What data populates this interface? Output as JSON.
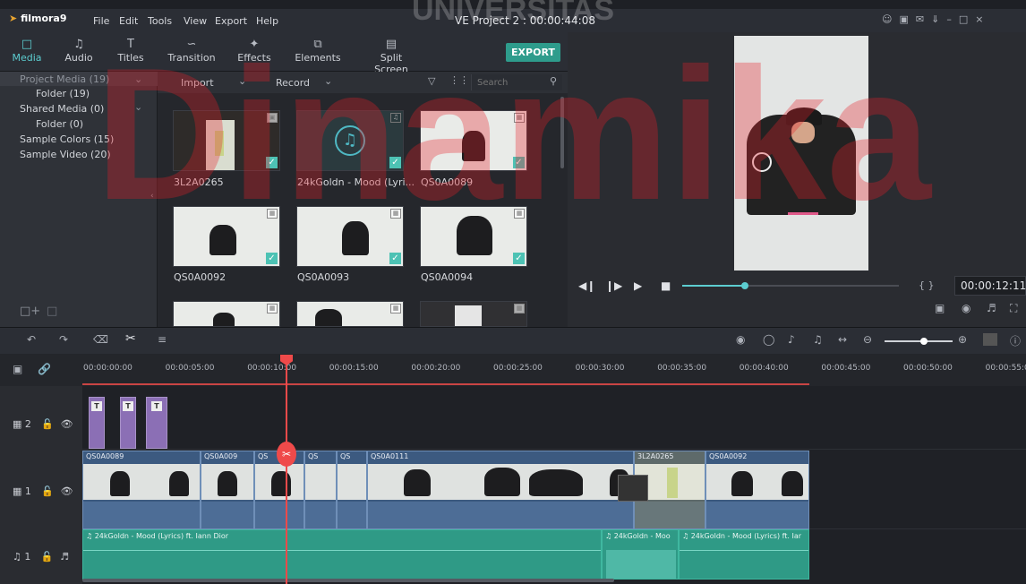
{
  "app": {
    "logo": "filmora9",
    "window_title": "VE Project 2 : 00:00:44:08"
  },
  "menu": [
    "File",
    "Edit",
    "Tools",
    "View",
    "Export",
    "Help"
  ],
  "watermark": "Dinamika",
  "watermark_top": "UNIVERSITAS",
  "toolbar": {
    "tabs": [
      {
        "label": "Media",
        "icon": "folder-icon"
      },
      {
        "label": "Audio",
        "icon": "music-note-icon"
      },
      {
        "label": "Titles",
        "icon": "text-icon"
      },
      {
        "label": "Transition",
        "icon": "transition-icon"
      },
      {
        "label": "Effects",
        "icon": "effects-icon"
      },
      {
        "label": "Elements",
        "icon": "elements-icon"
      },
      {
        "label": "Split Screen",
        "icon": "split-screen-icon"
      }
    ],
    "export_label": "EXPORT"
  },
  "library": {
    "items": [
      {
        "label": "Project Media (19)"
      },
      {
        "label": "Folder (19)"
      },
      {
        "label": "Shared Media (0)"
      },
      {
        "label": "Folder (0)"
      },
      {
        "label": "Sample Colors (15)"
      },
      {
        "label": "Sample Video (20)"
      }
    ]
  },
  "media_bar": {
    "import_label": "Import",
    "record_label": "Record",
    "search_placeholder": "Search"
  },
  "media": [
    {
      "label": "3L2A0265"
    },
    {
      "label": "24kGoldn - Mood (Lyri..."
    },
    {
      "label": "QS0A0089"
    },
    {
      "label": "QS0A0092"
    },
    {
      "label": "QS0A0093"
    },
    {
      "label": "QS0A0094"
    }
  ],
  "preview": {
    "timecode": "00:00:12:11",
    "braces": "{ }",
    "progress": 0.29
  },
  "ruler": [
    "00:00:00:00",
    "00:00:05:00",
    "00:00:10:00",
    "00:00:15:00",
    "00:00:20:00",
    "00:00:25:00",
    "00:00:30:00",
    "00:00:35:00",
    "00:00:40:00",
    "00:00:45:00",
    "00:00:50:00",
    "00:00:55:00"
  ],
  "tracks": {
    "title_track": "2",
    "video_track": "1",
    "audio_track": "1"
  },
  "video_clips": [
    "QS0A0089",
    "QS0A009",
    "QS",
    "QS",
    "QS",
    "QS0A0111",
    "3L2A0265",
    "QS0A0092"
  ],
  "audio_clips": [
    "24kGoldn - Mood (Lyrics) ft. Iann Dior",
    "24kGoldn - Moo",
    "24kGoldn - Mood (Lyrics) ft. Iar"
  ],
  "colors": {
    "accent": "#5ccdd0",
    "export": "#2e9c8c",
    "playhead": "#ef4a4a",
    "title_clip": "#8b6fb5",
    "audio_clip": "#2f9a86",
    "video_clip": "#3c5a80"
  }
}
